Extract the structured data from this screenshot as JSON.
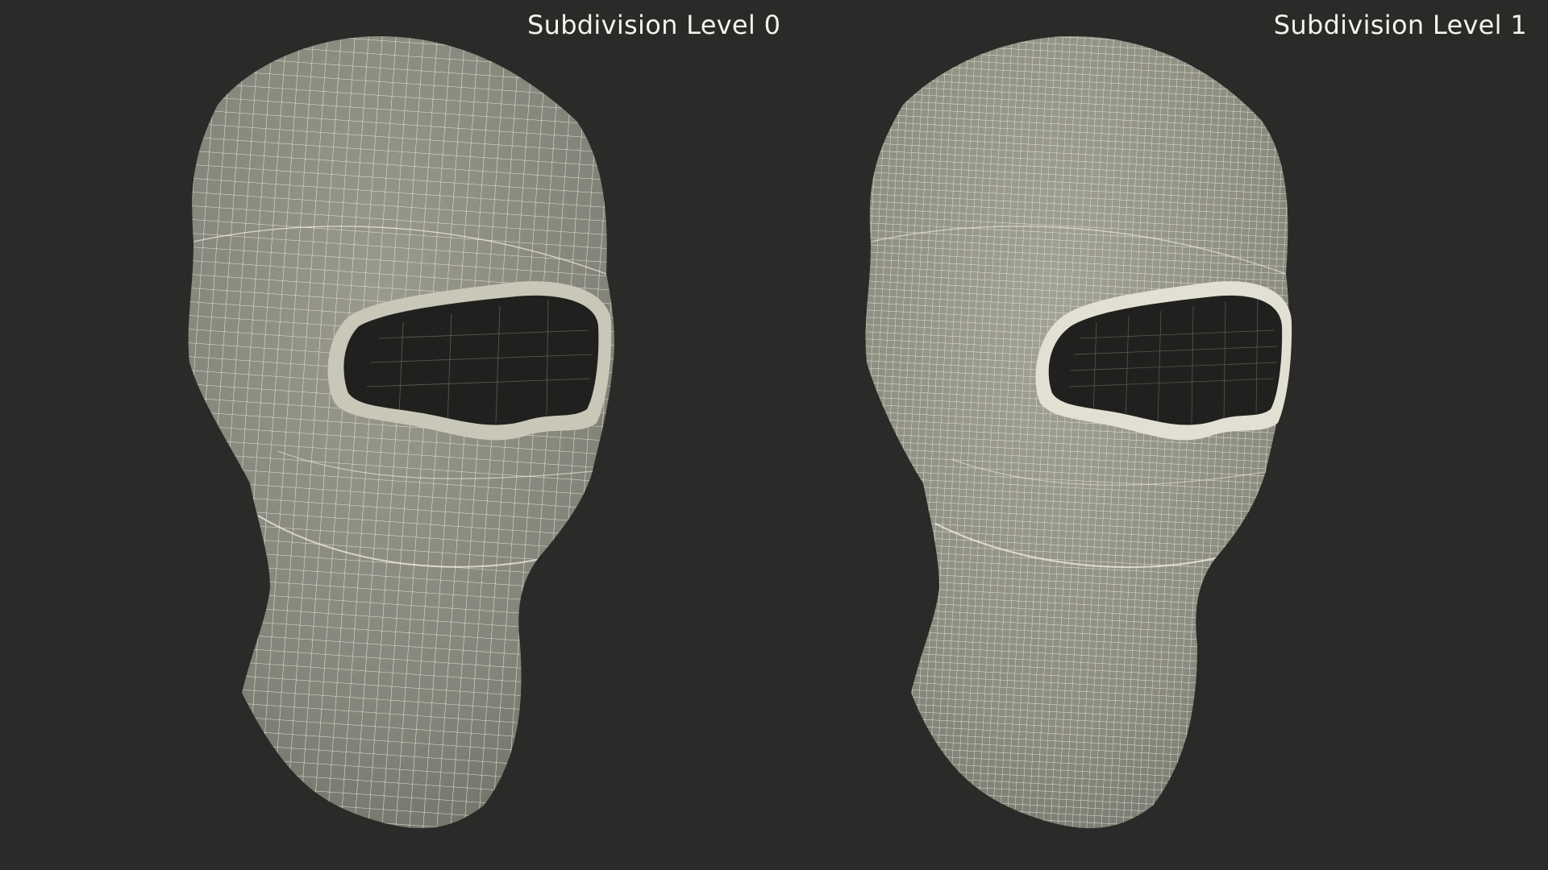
{
  "labels": {
    "left": "Subdivision Level 0",
    "right": "Subdivision Level 1"
  },
  "colors": {
    "background": "#2a2a28",
    "mesh_fill": "#8c8c80",
    "wire": "#f4f2e4",
    "eye_hole": "#20211f",
    "label_text": "#f2f2ee"
  },
  "models": [
    {
      "name": "balaclava",
      "subdivision_level": 0
    },
    {
      "name": "balaclava",
      "subdivision_level": 1
    }
  ]
}
